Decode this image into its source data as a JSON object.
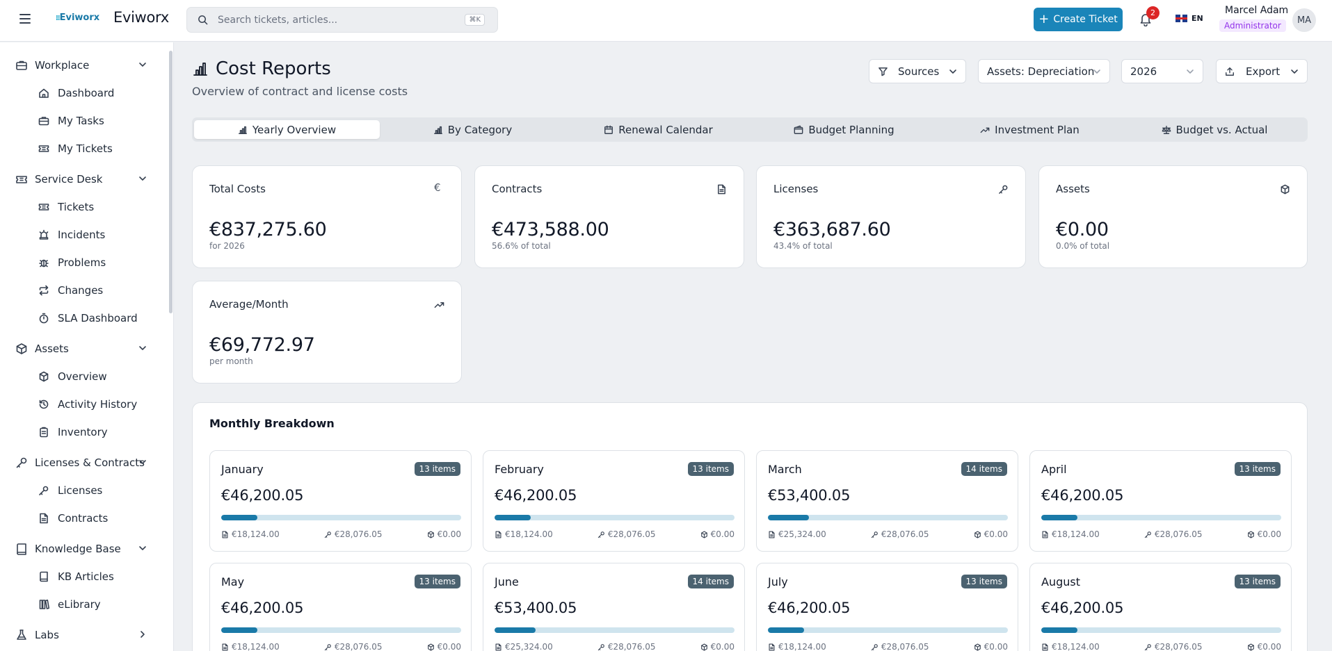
{
  "app": {
    "logo_mark": "Eviworx",
    "name": "Eviworx"
  },
  "search": {
    "placeholder": "Search tickets, articles...",
    "shortcut": "⌘K"
  },
  "header": {
    "create_label": "Create Ticket",
    "notifications": "2",
    "language": "EN",
    "user_name": "Marcel Adam",
    "user_role": "Administrator",
    "avatar_initials": "MA"
  },
  "sidebar": {
    "groups": [
      {
        "label": "Workplace",
        "items": [
          "Dashboard",
          "My Tasks",
          "My Tickets"
        ]
      },
      {
        "label": "Service Desk",
        "items": [
          "Tickets",
          "Incidents",
          "Problems",
          "Changes",
          "SLA Dashboard"
        ]
      },
      {
        "label": "Assets",
        "items": [
          "Overview",
          "Activity History",
          "Inventory"
        ]
      },
      {
        "label": "Licenses & Contracts",
        "items": [
          "Licenses",
          "Contracts"
        ]
      },
      {
        "label": "Knowledge Base",
        "items": [
          "KB Articles",
          "eLibrary"
        ]
      },
      {
        "label": "Labs",
        "items": []
      }
    ]
  },
  "page": {
    "title": "Cost Reports",
    "subtitle": "Overview of contract and license costs"
  },
  "filters": {
    "sources": "Sources",
    "asset_mode": "Assets: Depreciation",
    "year": "2026",
    "export": "Export"
  },
  "tabs": [
    "Yearly Overview",
    "By Category",
    "Renewal Calendar",
    "Budget Planning",
    "Investment Plan",
    "Budget vs. Actual"
  ],
  "stats": [
    {
      "label": "Total Costs",
      "value": "€837,275.60",
      "sub": "for 2026",
      "icon": "euro-icon"
    },
    {
      "label": "Contracts",
      "value": "€473,588.00",
      "sub": "56.6% of total",
      "icon": "file-icon"
    },
    {
      "label": "Licenses",
      "value": "€363,687.60",
      "sub": "43.4% of total",
      "icon": "key-icon"
    },
    {
      "label": "Assets",
      "value": "€0.00",
      "sub": "0.0% of total",
      "icon": "box-icon"
    },
    {
      "label": "Average/Month",
      "value": "€69,772.97",
      "sub": "per month",
      "icon": "trend-up-icon"
    }
  ],
  "breakdown": {
    "title": "Monthly Breakdown",
    "months": [
      {
        "name": "January",
        "items": "13 items",
        "total": "€46,200.05",
        "contracts": "€18,124.00",
        "licenses": "€28,076.05",
        "assets": "€0.00",
        "share": 0.15
      },
      {
        "name": "February",
        "items": "13 items",
        "total": "€46,200.05",
        "contracts": "€18,124.00",
        "licenses": "€28,076.05",
        "assets": "€0.00",
        "share": 0.15
      },
      {
        "name": "March",
        "items": "14 items",
        "total": "€53,400.05",
        "contracts": "€25,324.00",
        "licenses": "€28,076.05",
        "assets": "€0.00",
        "share": 0.17
      },
      {
        "name": "April",
        "items": "13 items",
        "total": "€46,200.05",
        "contracts": "€18,124.00",
        "licenses": "€28,076.05",
        "assets": "€0.00",
        "share": 0.15
      },
      {
        "name": "May",
        "items": "13 items",
        "total": "€46,200.05",
        "contracts": "€18,124.00",
        "licenses": "€28,076.05",
        "assets": "€0.00",
        "share": 0.15
      },
      {
        "name": "June",
        "items": "14 items",
        "total": "€53,400.05",
        "contracts": "€25,324.00",
        "licenses": "€28,076.05",
        "assets": "€0.00",
        "share": 0.17
      },
      {
        "name": "July",
        "items": "13 items",
        "total": "€46,200.05",
        "contracts": "€18,124.00",
        "licenses": "€28,076.05",
        "assets": "€0.00",
        "share": 0.15
      },
      {
        "name": "August",
        "items": "13 items",
        "total": "€46,200.05",
        "contracts": "€18,124.00",
        "licenses": "€28,076.05",
        "assets": "€0.00",
        "share": 0.15
      }
    ]
  },
  "colors": {
    "accent": "#1a85b9",
    "badge": "#4b6270",
    "role": "#9333ea"
  }
}
